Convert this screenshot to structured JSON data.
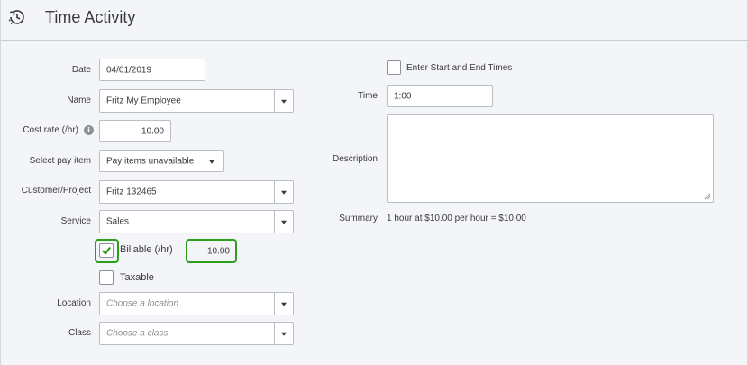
{
  "header": {
    "title": "Time Activity",
    "icon": "clock-history-icon"
  },
  "form": {
    "date": {
      "label": "Date",
      "value": "04/01/2019"
    },
    "name": {
      "label": "Name",
      "value": "Fritz My Employee"
    },
    "cost_rate": {
      "label": "Cost rate (/hr)",
      "value": "10.00",
      "info_icon": "i"
    },
    "pay_item": {
      "label": "Select pay item",
      "value": "Pay items unavailable"
    },
    "customer": {
      "label": "Customer/Project",
      "value": "Fritz 132465"
    },
    "service": {
      "label": "Service",
      "value": "Sales"
    },
    "billable": {
      "label": "Billable (/hr)",
      "checked": true,
      "rate": "10.00"
    },
    "taxable": {
      "label": "Taxable",
      "checked": false
    },
    "location": {
      "label": "Location",
      "placeholder": "Choose a location"
    },
    "class": {
      "label": "Class",
      "placeholder": "Choose a class"
    },
    "start_end": {
      "label": "Enter Start and End Times",
      "checked": false
    },
    "time": {
      "label": "Time",
      "value": "1:00"
    },
    "description": {
      "label": "Description",
      "value": ""
    },
    "summary": {
      "label": "Summary",
      "value": "1 hour at $10.00 per hour = $10.00"
    }
  },
  "colors": {
    "highlight": "#2ca01c",
    "background": "#f4f5f8",
    "border": "#babec5"
  }
}
